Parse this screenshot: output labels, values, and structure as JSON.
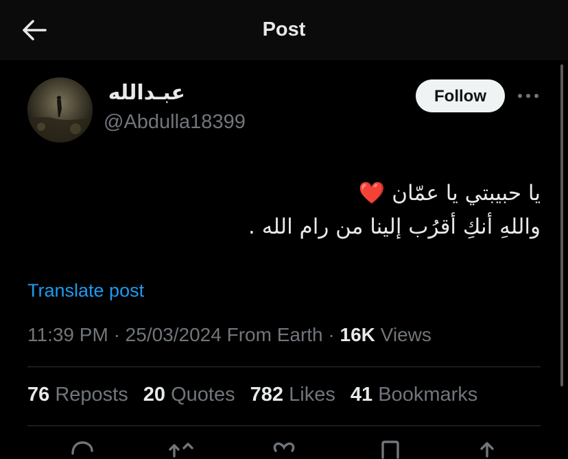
{
  "header": {
    "title": "Post",
    "back_icon": "arrow-left-icon"
  },
  "author": {
    "display_name": "عبـدالله",
    "handle": "@Abdulla18399",
    "follow_label": "Follow",
    "more_icon": "more-horizontal-icon"
  },
  "post": {
    "lines": [
      "يا حبيبتي يا عمّان ❤️",
      "واللهِ أنكِ أقرُب إلينا من رام الله ."
    ],
    "translate_label": "Translate post"
  },
  "meta": {
    "time": "11:39 PM",
    "date": "25/03/2024",
    "location": "From Earth",
    "views_count": "16K",
    "views_label": "Views",
    "separator": "·"
  },
  "stats": {
    "reposts_count": "76",
    "reposts_label": "Reposts",
    "quotes_count": "20",
    "quotes_label": "Quotes",
    "likes_count": "782",
    "likes_label": "Likes",
    "bookmarks_count": "41",
    "bookmarks_label": "Bookmarks"
  },
  "actions": [
    "reply-icon",
    "repost-icon",
    "like-icon",
    "bookmark-icon",
    "share-icon"
  ],
  "colors": {
    "background": "#000000",
    "header_background": "#0b0b0b",
    "text_primary": "#e7e9ea",
    "text_secondary": "#71767b",
    "link": "#1d9bf0",
    "follow_bg": "#eff3f4",
    "divider": "#2f3336"
  }
}
